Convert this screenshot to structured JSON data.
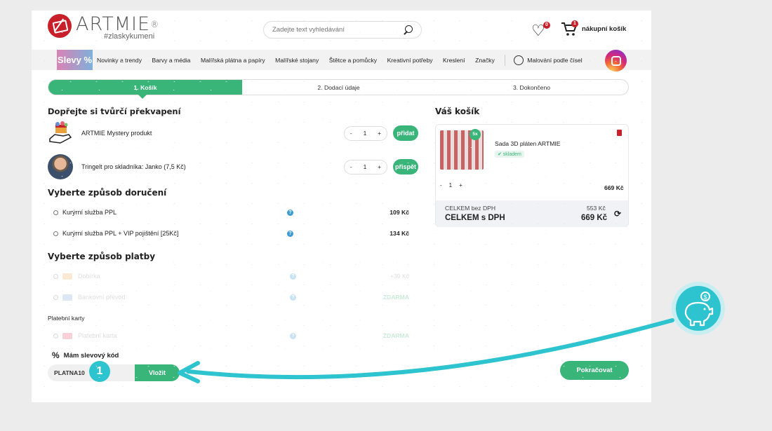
{
  "header": {
    "logo_name": "ARTMIE",
    "logo_reg": "®",
    "logo_tag": "#zlaskykumeni",
    "search_placeholder": "Zadejte text vyhledávání",
    "fav_count": "0",
    "cart_count": "1",
    "cart_label": "nákupní košík"
  },
  "nav": {
    "sale": "Slevy %",
    "items": [
      "Novinky a trendy",
      "Barvy a média",
      "Malířská plátna a papíry",
      "Malířské stojany",
      "Štětce a pomůcky",
      "Kreativní potřeby",
      "Kreslení",
      "Značky"
    ],
    "paint_numbers": "Malování podle čísel"
  },
  "steps": [
    "1. Košík",
    "2. Dodací údaje",
    "3. Dokončeno"
  ],
  "surprise": {
    "title": "Dopřejte si tvůrčí překvapení",
    "products": [
      {
        "name": "ARTMIE Mystery produkt",
        "qty": "1",
        "button": "přidat"
      },
      {
        "name": "Tringelt pro skladníka: Janko (7,5 Kč)",
        "qty": "1",
        "button": "přispět"
      }
    ]
  },
  "delivery": {
    "title": "Vyberte způsob doručení",
    "options": [
      {
        "label": "Kurýrní služba PPL",
        "price": "109 Kč"
      },
      {
        "label": "Kurýrní služba PPL + VIP pojištění [25Kč]",
        "price": "134 Kč"
      }
    ]
  },
  "payment": {
    "title": "Vyberte způsob platby",
    "options": [
      {
        "label": "Dobírka",
        "price": "+39 Kč",
        "icon_color": "#f2b36b"
      },
      {
        "label": "Bankovní převod",
        "price": "ZDARMA",
        "icon_color": "#7fb0d9"
      }
    ],
    "cards_label": "Platební karty",
    "card_option": {
      "label": "Platební karta",
      "price": "ZDARMA",
      "icon_color": "#e85d75"
    }
  },
  "coupon": {
    "title": "Mám slevový kód",
    "value": "PLATNA10",
    "button": "Vložit",
    "marker": "1"
  },
  "continue": "Pokračovat",
  "cart": {
    "title": "Váš košík",
    "item_name": "Sada 3D pláten ARTMIE",
    "badge": "5x",
    "stock": "✔ skladem",
    "qty": "1",
    "item_price": "669 Kč",
    "total_no_vat_label": "CELKEM bez DPH",
    "total_no_vat": "553 Kč",
    "total_vat_label": "CELKEM s DPH",
    "total_vat": "669 Kč"
  },
  "colors": {
    "accent": "#3ab57a",
    "brand": "#c8202a",
    "overlay": "#2ec4cf"
  }
}
